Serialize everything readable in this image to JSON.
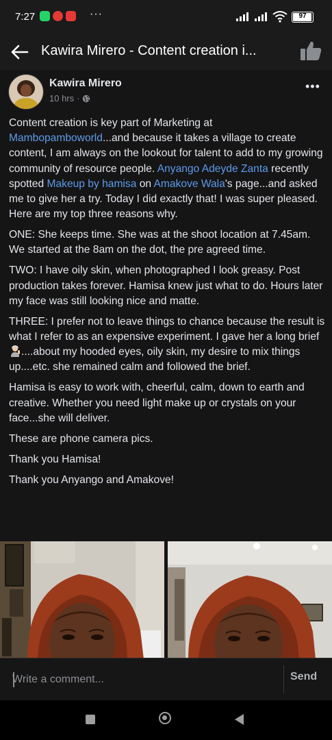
{
  "status_bar": {
    "time": "7:27",
    "battery_level": "97",
    "icons": [
      "whatsapp-icon",
      "opera-icon",
      "news-icon",
      "more-notifications-icon",
      "signal-icon",
      "signal-icon",
      "wifi-icon",
      "battery-icon"
    ]
  },
  "app_bar": {
    "title": "Kawira Mirero - Content creation i...",
    "icons": [
      "back-arrow-icon",
      "thumbs-up-icon"
    ]
  },
  "post": {
    "author": "Kawira Mirero",
    "time": "10 hrs",
    "separator": "·",
    "privacy_icon": "globe-icon",
    "options_label": "•••",
    "p1": {
      "t1": "Content creation is key part of Marketing at ",
      "m1": "Mambopamboworld",
      "t2": "...and because it takes a village to create content, I am always on the lookout for talent to add to my growing community of resource people. ",
      "m2": "Anyango Adeyde Zanta",
      "t3": " recently spotted ",
      "m3": "Makeup by hamisa",
      "t4": " on ",
      "m4": "Amakove Wala",
      "t5": "'s page...and asked me to give her a try. Today I did exactly that! I was super pleased. Here are my top three reasons why."
    },
    "p2": "ONE: She keeps time. She was at the shoot location at 7.45am. We started at the 8am on the dot, the pre agreed time.",
    "p3": "TWO: I have oily skin, when photographed I look greasy. Post production takes forever. Hamisa knew just what to do. Hours later my face was still looking nice and matte.",
    "p4": {
      "t1": "THREE: I prefer not to leave things to chance because the result is what I refer to as an expensive experiment. I gave her a long brief ",
      "emoji_icon": "woman-gesturing-emoji-icon",
      "t2": "....about my hooded eyes, oily skin, my desire to mix things up....etc. she remained calm and followed the brief."
    },
    "p5": "Hamisa is easy to work with, cheerful, calm, down to earth and creative. Whether you need light make up or crystals on your face...she will deliver.",
    "p6": "These are phone camera pics.",
    "p7": "Thank you Hamisa!",
    "p8": "Thank you Anyango and Amakove!",
    "mention_color": "#5e9bea"
  },
  "comment_bar": {
    "placeholder": "Write a comment...",
    "send_label": "Send"
  },
  "nav_bar": {
    "icons": [
      "recents-icon",
      "home-icon",
      "back-icon"
    ]
  },
  "colors": {
    "background": "#151516",
    "text": "#e4e6eb",
    "secondary_text": "#8a8d91",
    "link": "#5e9bea"
  }
}
